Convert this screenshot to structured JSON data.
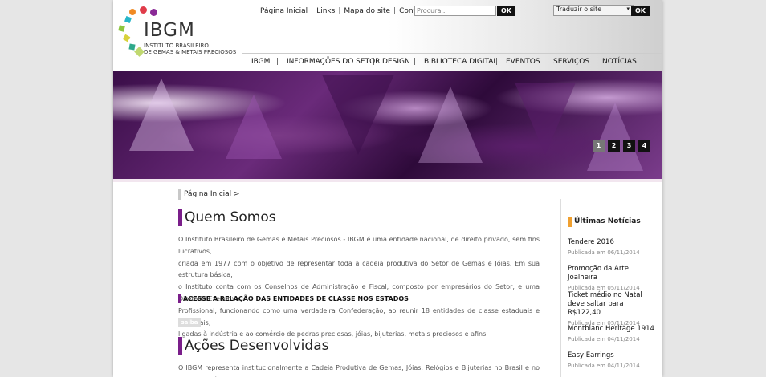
{
  "logo": {
    "name": "IBGM",
    "subtitle_line1": "Instituto Brasileiro",
    "subtitle_line2": "de Gemas & Metais Preciosos"
  },
  "toplinks": [
    "Página Inicial",
    "Links",
    "Mapa do site",
    "Contato"
  ],
  "search": {
    "placeholder": "Procura..",
    "button": "OK"
  },
  "translate": {
    "label": "Traduzir o site",
    "button": "OK"
  },
  "nav": [
    "IBGM",
    "INFORMAÇÕES DO SETOR",
    "DESIGN",
    "BIBLIOTECA DIGITAL",
    "EVENTOS",
    "SERVIÇOS",
    "NOTÍCIAS"
  ],
  "slider": {
    "pages": [
      "1",
      "2",
      "3",
      "4"
    ],
    "active": "1"
  },
  "breadcrumb": "Página Inicial >",
  "sections": {
    "quem_somos": {
      "title": "Quem Somos",
      "lines": [
        "O Instituto Brasileiro de Gemas e Metais Preciosos - IBGM é uma entidade nacional, de direito privado, sem fins lucrativos,",
        "criada em 1977 com o objetivo de representar toda a cadeia produtiva do Setor de Gemas e Jóias.  Em sua estrutura básica,",
        "o Instituto conta com os Conselhos de Administração e Fiscal, composto por empresários do Setor, e uma Diretoria Executiva",
        "Profissional, funcionando como uma verdadeira Confederação, ao reunir 18 entidades de classe estaduais e nacionais,",
        "ligadas à indústria e ao comércio de pedras preciosas, jóias, bijuterias, metais preciosos e afins."
      ],
      "link": "ACESSE A RELAÇÃO DAS ENTIDADES DE CLASSE NOS ESTADOS",
      "saiba": "saiba +"
    },
    "acoes": {
      "title": "Ações Desenvolvidas",
      "line": "O IBGM  representa institucionalmente a Cadeia Produtiva de Gemas, Jóias, Relógios e Bijuterias no Brasil e no exterior, além"
    }
  },
  "sidebar": {
    "title": "Últimas Notícias",
    "news": [
      {
        "title": "Tendere 2016",
        "date": "Publicada em 06/11/2014"
      },
      {
        "title": "Promoção da Arte Joalheira",
        "date": "Publicada em 05/11/2014"
      },
      {
        "title": "Ticket médio no Natal deve saltar para R$122,40",
        "date": "Publicada em 05/11/2014"
      },
      {
        "title": "Montblanc Heritage 1914",
        "date": "Publicada em 04/11/2014"
      },
      {
        "title": "Easy Earrings",
        "date": "Publicada em 04/11/2014"
      }
    ]
  },
  "colors": {
    "accent": "#7a1e8a",
    "sidebar_accent": "#f0a030",
    "button": "#111111"
  }
}
